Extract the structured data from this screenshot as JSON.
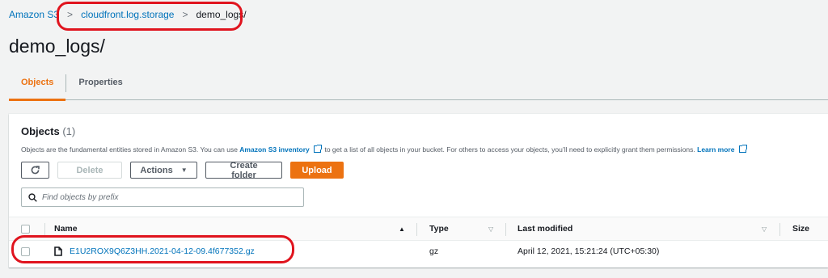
{
  "breadcrumb": {
    "root": "Amazon S3",
    "bucket": "cloudfront.log.storage",
    "current": "demo_logs/"
  },
  "page_title": "demo_logs/",
  "tabs": [
    {
      "label": "Objects",
      "active": true
    },
    {
      "label": "Properties",
      "active": false
    }
  ],
  "panel": {
    "title": "Objects",
    "count": "(1)",
    "description": {
      "before": "Objects are the fundamental entities stored in Amazon S3. You can use",
      "link1": "Amazon S3 inventory",
      "middle": "to get a list of all objects in your bucket. For others to access your objects, you’ll need to explicitly grant them permissions.",
      "link2": "Learn more"
    }
  },
  "toolbar": {
    "refresh_icon": "refresh-icon",
    "delete_label": "Delete",
    "actions_label": "Actions",
    "create_folder_label": "Create folder",
    "upload_label": "Upload"
  },
  "search": {
    "placeholder": "Find objects by prefix"
  },
  "table": {
    "headers": {
      "name": "Name",
      "type": "Type",
      "last_modified": "Last modified",
      "size": "Size"
    },
    "rows": [
      {
        "name": "E1U2ROX9Q6Z3HH.2021-04-12-09.4f677352.gz",
        "type": "gz",
        "last_modified": "April 12, 2021, 15:21:24 (UTC+05:30)"
      }
    ]
  },
  "colors": {
    "accent": "#ec7211",
    "link": "#0073bb",
    "annotation": "#e0141e"
  }
}
